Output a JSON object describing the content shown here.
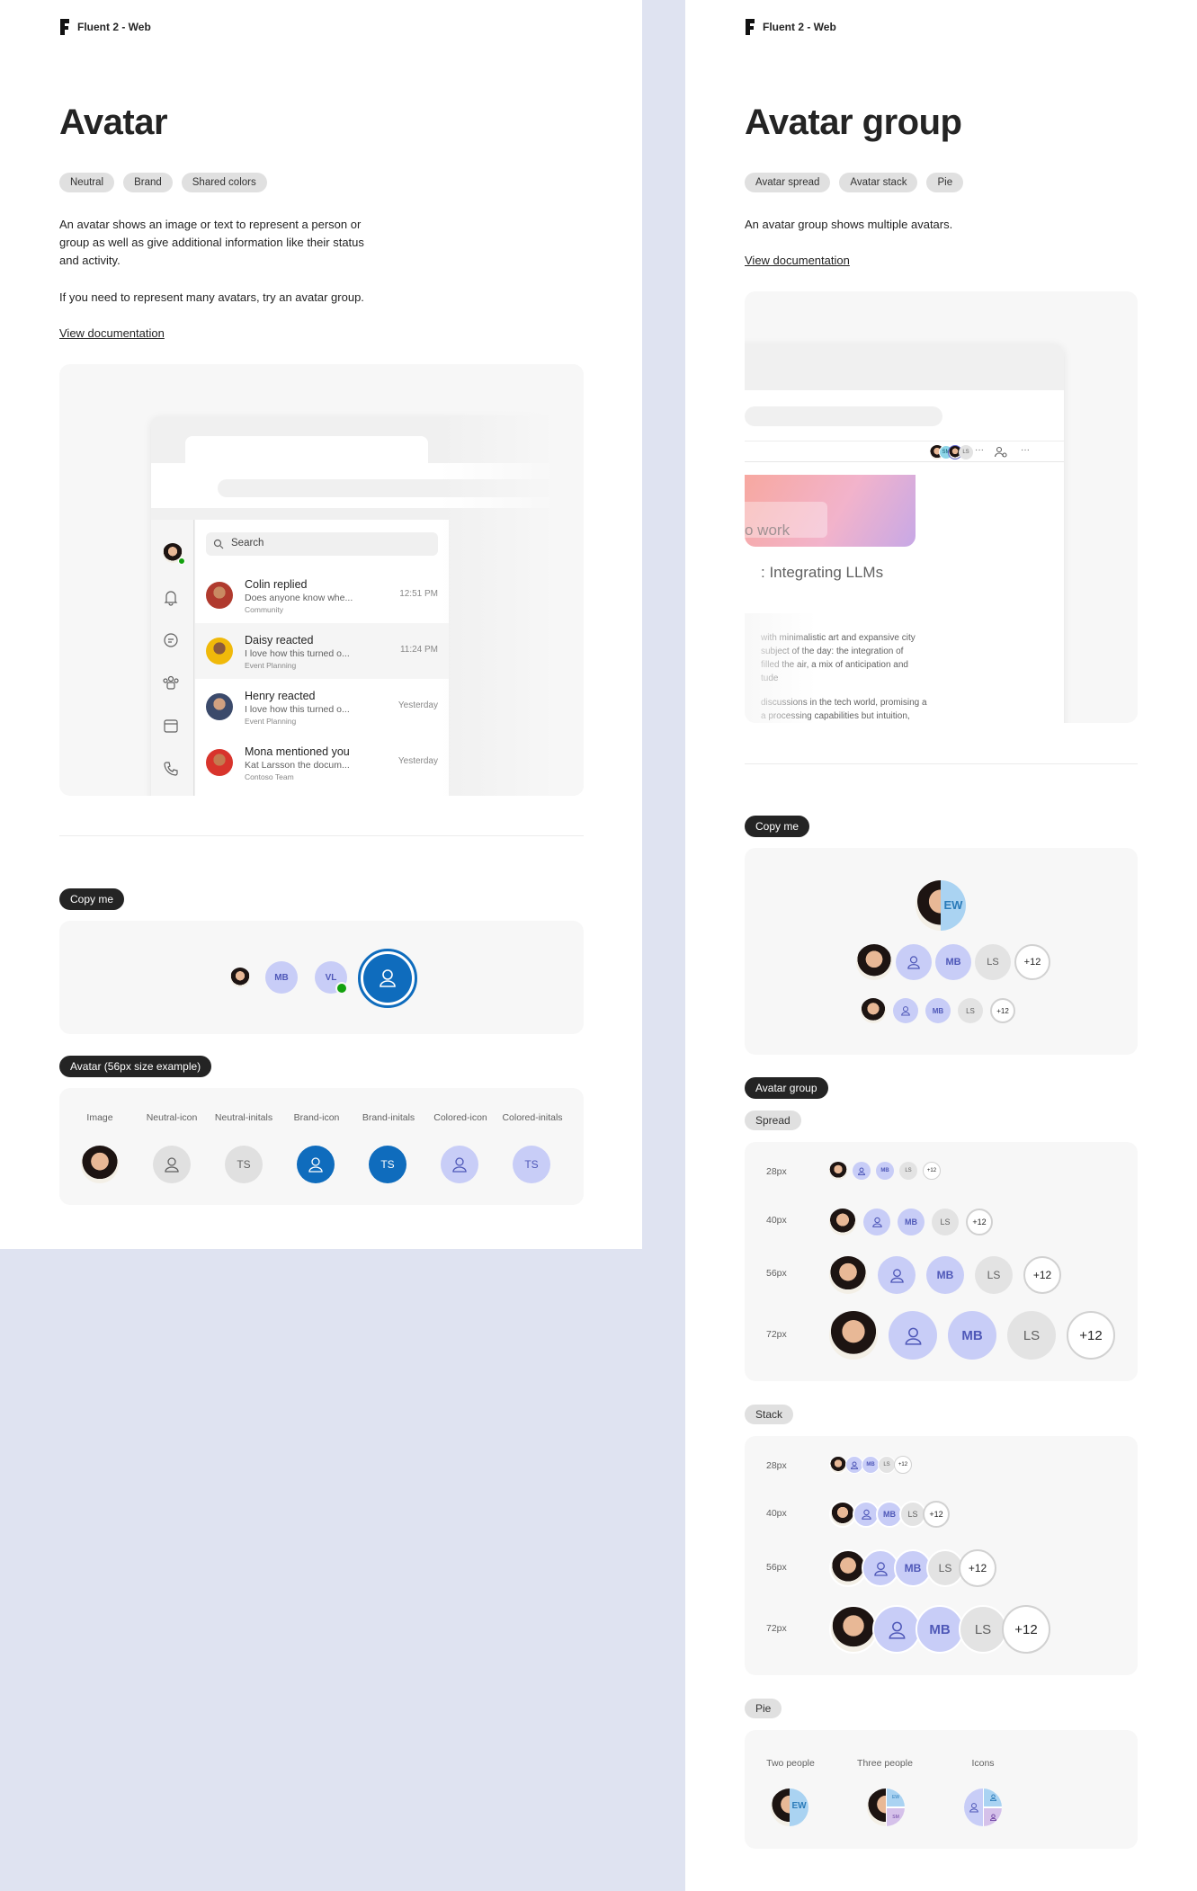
{
  "left": {
    "brand": "Fluent 2 - Web",
    "title": "Avatar",
    "tags": [
      "Neutral",
      "Brand",
      "Shared colors"
    ],
    "description": "An avatar shows an image or text to represent a person or group as well as give additional information like their status and activity.",
    "hint": "If you need to represent many avatars, try an avatar group.",
    "doc_link": "View documentation",
    "mock": {
      "search_placeholder": "Search",
      "items": [
        {
          "name": "Colin replied",
          "preview": "Does anyone know whe...",
          "sub": "Community",
          "time": "12:51 PM"
        },
        {
          "name": "Daisy reacted",
          "preview": "I love how this turned o...",
          "sub": "Event Planning",
          "time": "11:24 PM"
        },
        {
          "name": "Henry reacted",
          "preview": "I love how this turned o...",
          "sub": "Event Planning",
          "time": "Yesterday"
        },
        {
          "name": "Mona mentioned you",
          "preview": "Kat Larsson the docum...",
          "sub": "Contoso Team",
          "time": "Yesterday"
        }
      ]
    },
    "copy_me": "Copy me",
    "copy_avatars": {
      "mb": "MB",
      "vl": "VL"
    },
    "size_section": "Avatar (56px size example)",
    "variants": [
      {
        "label": "Image"
      },
      {
        "label": "Neutral-icon"
      },
      {
        "label": "Neutral-initals",
        "text": "TS"
      },
      {
        "label": "Brand-icon"
      },
      {
        "label": "Brand-initals",
        "text": "TS"
      },
      {
        "label": "Colored-icon"
      },
      {
        "label": "Colored-initals",
        "text": "TS"
      }
    ]
  },
  "right": {
    "brand": "Fluent 2 - Web",
    "title": "Avatar group",
    "tags": [
      "Avatar spread",
      "Avatar stack",
      "Pie"
    ],
    "description": "An avatar group shows multiple avatars.",
    "doc_link": "View documentation",
    "mock": {
      "headline_fragment": "o work",
      "article_title": ": Integrating LLMs",
      "body_lines": [
        "with minimalistic art and expansive city",
        "subject of the day: the integration of",
        "filled the air, a mix of anticipation and",
        "tude"
      ],
      "body_lines2": [
        "discussions in the tech world, promising a",
        "a processing capabilities but intuition,"
      ],
      "mini_initials": {
        "sm": "SM",
        "ls": "LS"
      }
    },
    "copy_me": "Copy me",
    "pie_top": "EW",
    "group_initials": {
      "mb": "MB",
      "ls": "LS",
      "more": "+12"
    },
    "group_section": "Avatar group",
    "spread": "Spread",
    "stack": "Stack",
    "pie": "Pie",
    "sizes": [
      "28px",
      "40px",
      "56px",
      "72px"
    ],
    "pie_labels": [
      "Two people",
      "Three people",
      "Icons"
    ],
    "pie_initials": {
      "ew": "EW",
      "sm": "SM"
    }
  }
}
